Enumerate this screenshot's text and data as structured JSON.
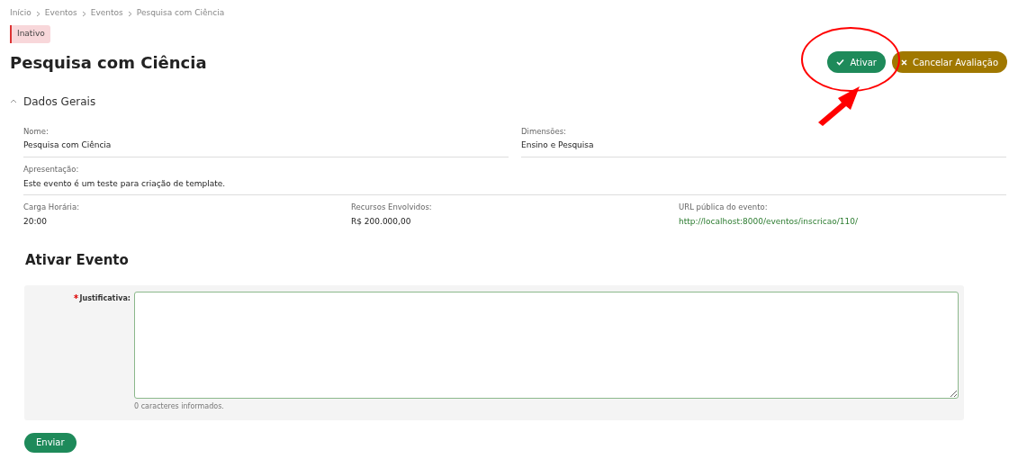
{
  "breadcrumb": [
    "Início",
    "Eventos",
    "Eventos",
    "Pesquisa com Ciência"
  ],
  "status_badge": "Inativo",
  "title": "Pesquisa com Ciência",
  "actions": [
    {
      "kind": "confirm",
      "label": "Ativar"
    },
    {
      "kind": "cancel",
      "label": "Cancelar Avaliação"
    }
  ],
  "section": {
    "title": "Dados Gerais",
    "expanded": true
  },
  "details": [
    {
      "divider": true,
      "fields": [
        {
          "label": "Nome:",
          "value": "Pesquisa com Ciência",
          "kind": "text"
        },
        {
          "label": "Dimensões:",
          "value": "Ensino e Pesquisa",
          "kind": "text"
        }
      ]
    },
    {
      "divider": true,
      "fields": [
        {
          "label": "Apresentação:",
          "value": "Este evento é um teste para criação de template.",
          "kind": "text"
        }
      ]
    },
    {
      "divider": false,
      "fields": [
        {
          "label": "Carga Horária:",
          "value": "20:00",
          "kind": "text"
        },
        {
          "label": "Recursos Envolvidos:",
          "value": "R$ 200.000,00",
          "kind": "text"
        },
        {
          "label": "URL pública do evento:",
          "value": "http://localhost:8000/eventos/inscricao/110/",
          "kind": "link"
        }
      ]
    }
  ],
  "form": {
    "title": "Ativar Evento",
    "field": {
      "label": "Justificativa:",
      "required": true,
      "counter": "0 caracteres informados."
    },
    "submit": "Enviar"
  }
}
